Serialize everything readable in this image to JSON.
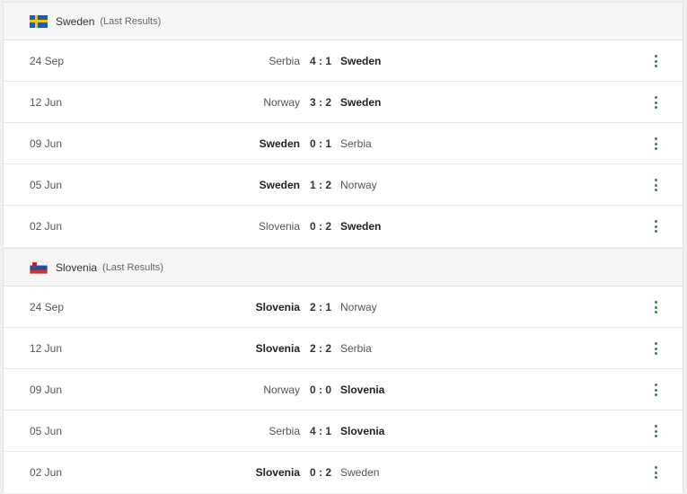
{
  "sections": [
    {
      "team": "Sweden",
      "subtitle": "(Last Results)",
      "flag_icon": "sweden-flag-icon",
      "matches": [
        {
          "date": "24 Sep",
          "home": "Serbia",
          "score": "4 : 1",
          "away": "Sweden",
          "bold": "away"
        },
        {
          "date": "12 Jun",
          "home": "Norway",
          "score": "3 : 2",
          "away": "Sweden",
          "bold": "away"
        },
        {
          "date": "09 Jun",
          "home": "Sweden",
          "score": "0 : 1",
          "away": "Serbia",
          "bold": "home"
        },
        {
          "date": "05 Jun",
          "home": "Sweden",
          "score": "1 : 2",
          "away": "Norway",
          "bold": "home"
        },
        {
          "date": "02 Jun",
          "home": "Slovenia",
          "score": "0 : 2",
          "away": "Sweden",
          "bold": "away"
        }
      ]
    },
    {
      "team": "Slovenia",
      "subtitle": "(Last Results)",
      "flag_icon": "slovenia-flag-icon",
      "matches": [
        {
          "date": "24 Sep",
          "home": "Slovenia",
          "score": "2 : 1",
          "away": "Norway",
          "bold": "home"
        },
        {
          "date": "12 Jun",
          "home": "Slovenia",
          "score": "2 : 2",
          "away": "Serbia",
          "bold": "home"
        },
        {
          "date": "09 Jun",
          "home": "Norway",
          "score": "0 : 0",
          "away": "Slovenia",
          "bold": "away"
        },
        {
          "date": "05 Jun",
          "home": "Serbia",
          "score": "4 : 1",
          "away": "Slovenia",
          "bold": "away"
        },
        {
          "date": "02 Jun",
          "home": "Slovenia",
          "score": "0 : 2",
          "away": "Sweden",
          "bold": "home"
        }
      ]
    }
  ],
  "colors": {
    "accent_dots": "#2e8b3a",
    "sweden_blue": "#1a5fb4",
    "sweden_yellow": "#f6c400",
    "slovenia_blue": "#1c4fa3",
    "slovenia_red": "#e02a25"
  },
  "icons": {
    "row_menu": "more-vertical-icon"
  }
}
